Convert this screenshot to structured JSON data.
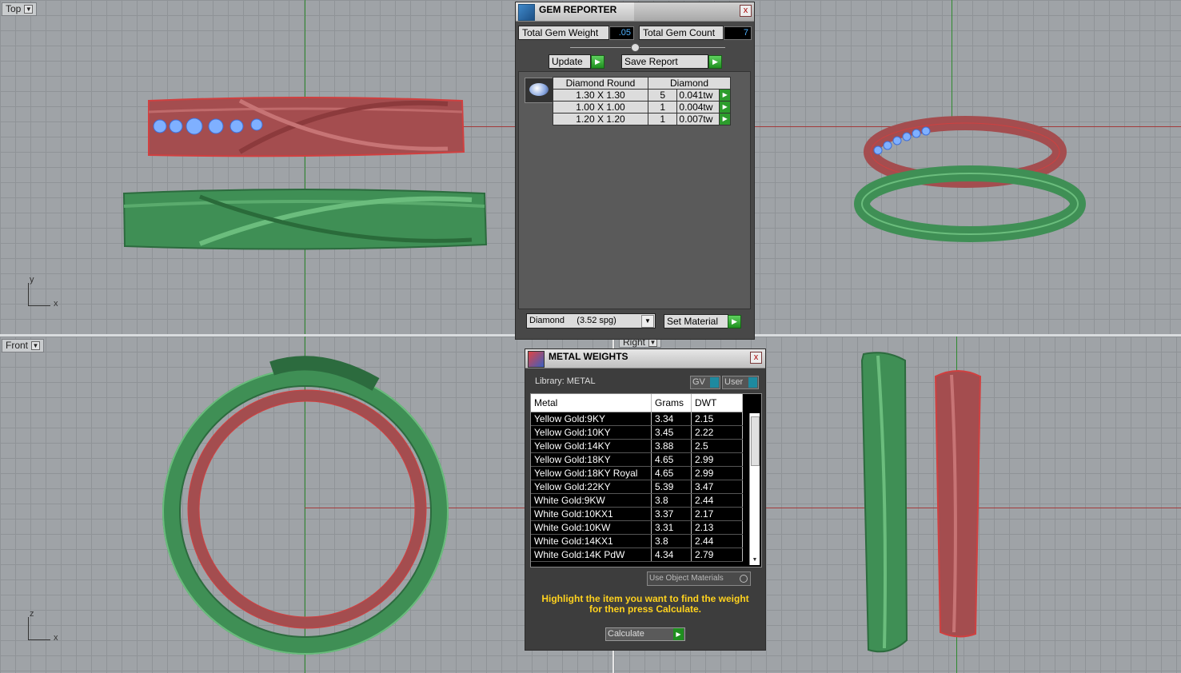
{
  "viewports": {
    "top": {
      "label": "Top",
      "axis_y": "y",
      "axis_x": "x"
    },
    "front": {
      "label": "Front",
      "axis_y": "z",
      "axis_x": "x"
    },
    "right": {
      "label": "Right"
    }
  },
  "gem_reporter": {
    "title": "GEM REPORTER",
    "close": "x",
    "total_weight_label": "Total Gem Weight",
    "total_weight_value": ".05",
    "total_count_label": "Total Gem Count",
    "total_count_value": "7",
    "update_label": "Update",
    "save_label": "Save Report",
    "columns": [
      "Diamond Round",
      "Diamond"
    ],
    "rows": [
      {
        "size": "1.30 X 1.30",
        "count": "5",
        "weight": "0.041tw"
      },
      {
        "size": "1.00 X 1.00",
        "count": "1",
        "weight": "0.004tw"
      },
      {
        "size": "1.20 X 1.20",
        "count": "1",
        "weight": "0.007tw"
      }
    ],
    "material_select": "Diamond     (3.52 spg)",
    "set_material_label": "Set Material"
  },
  "metal_weights": {
    "title": "METAL WEIGHTS",
    "close": "x",
    "library_label": "Library: METAL",
    "gv_label": "GV",
    "user_label": "User",
    "columns": [
      "Metal",
      "Grams",
      "DWT"
    ],
    "rows": [
      {
        "metal": "Yellow Gold:9KY",
        "grams": "3.34",
        "dwt": "2.15"
      },
      {
        "metal": "Yellow Gold:10KY",
        "grams": "3.45",
        "dwt": "2.22"
      },
      {
        "metal": "Yellow Gold:14KY",
        "grams": "3.88",
        "dwt": "2.5"
      },
      {
        "metal": "Yellow Gold:18KY",
        "grams": "4.65",
        "dwt": "2.99"
      },
      {
        "metal": "Yellow Gold:18KY Royal",
        "grams": "4.65",
        "dwt": "2.99"
      },
      {
        "metal": "Yellow Gold:22KY",
        "grams": "5.39",
        "dwt": "3.47"
      },
      {
        "metal": "White Gold:9KW",
        "grams": "3.8",
        "dwt": "2.44"
      },
      {
        "metal": "White Gold:10KX1",
        "grams": "3.37",
        "dwt": "2.17"
      },
      {
        "metal": "White Gold:10KW",
        "grams": "3.31",
        "dwt": "2.13"
      },
      {
        "metal": "White Gold:14KX1",
        "grams": "3.8",
        "dwt": "2.44"
      },
      {
        "metal": "White Gold:14K PdW",
        "grams": "4.34",
        "dwt": "2.79"
      }
    ],
    "use_object_materials": "Use Object Materials",
    "instruction": "Highlight the item you want to find the weight for then press Calculate.",
    "calculate_label": "Calculate"
  },
  "colors": {
    "ring_red": "#a44d4f",
    "ring_green": "#3f8f55",
    "gem_blue": "#6f9fe8",
    "instruction_text": "#ffd21e",
    "value_text": "#4fb2ff"
  }
}
